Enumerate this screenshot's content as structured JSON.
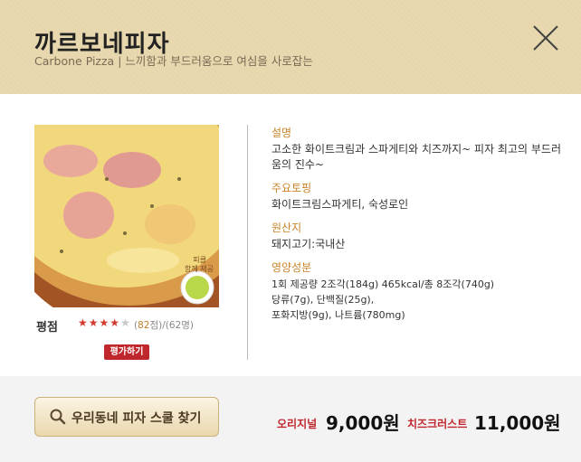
{
  "header": {
    "title": "까르보네피자",
    "subtitle": "Carbone Pizza | 느끼함과 부드러움으로 여심을 사로잡는"
  },
  "product_image": {
    "badge_line1": "피클",
    "badge_line2": "함께 제공"
  },
  "rating": {
    "label": "평점",
    "stars_filled": 4,
    "stars_total": 5,
    "count_open": "(",
    "count": "82",
    "count_unit": "점",
    "voters": ")/(62명)",
    "button": "평가하기"
  },
  "info": {
    "desc_label": "설명",
    "desc": "고소한 화이트크림과 스파게티와 치즈까지~ 피자 최고의 부드러움의 진수~",
    "topping_label": "주요토핑",
    "topping": "화이트크림스파게티, 숙성로인",
    "origin_label": "원산지",
    "origin": "돼지고기:국내산",
    "nutrition_label": "영양성분",
    "nutrition_1": "1회 제공량 2조각(184g) 465kcal/총 8조각(740g)",
    "nutrition_2": "당류(7g), 단백질(25g),",
    "nutrition_3": "포화지방(9g), 나트륨(780mg)"
  },
  "footer": {
    "search_button": "우리동네 피자 스쿨 찾기",
    "price_original_label": "오리지널",
    "price_original": "9,000원",
    "price_cheesecrust_label": "치즈크러스트",
    "price_cheesecrust": "11,000원"
  },
  "colors": {
    "header_bg": "#e6d6ab",
    "accent_red": "#c0272d",
    "label_orange": "#c8842a"
  }
}
